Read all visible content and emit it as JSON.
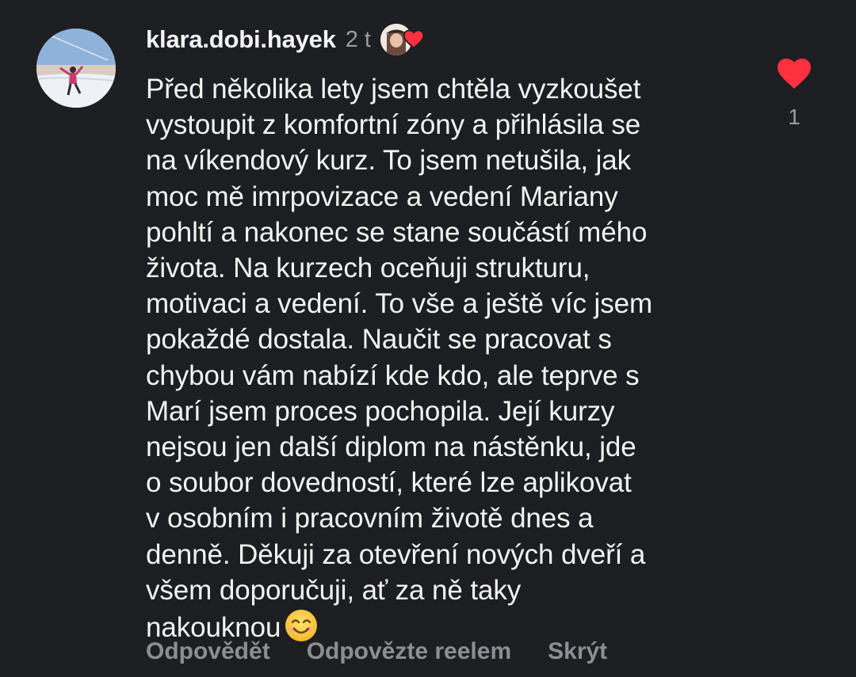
{
  "comment": {
    "username": "klara.dobi.hayek",
    "time": "2 t",
    "text": "Před několika lety jsem chtěla vyzkoušet\nvystoupit z komfortní zóny a přihlásila se\nna víkendový kurz. To jsem netušila, jak\nmoc mě imrpovizace a vedení Mariany\npohltí a nakonec se stane součástí mého\nživota. Na kurzech oceňuji strukturu,\nmotivaci a vedení. To vše a ještě víc jsem\npokaždé dostala. Naučit se pracovat s\nchybou vám nabízí kde kdo, ale teprve s\nMarí jsem proces pochopila. Její kurzy\nnejsou jen další diplom na nástěnku, jde\no soubor dovedností, které lze aplikovat\nv osobním i pracovním životě dnes a\ndenně. Děkuji za otevření nových dveří a\nvšem doporučuji, ať za ně taky\nnakouknou",
    "emoji_icon": "smiling-face-emoji",
    "like_count": "1"
  },
  "actions": {
    "reply": "Odpovědět",
    "reply_reel": "Odpovězte reelem",
    "hide": "Skrýt"
  },
  "colors": {
    "background": "#1d1e22",
    "heart": "#ff3040",
    "muted_text": "#8d8e93"
  }
}
